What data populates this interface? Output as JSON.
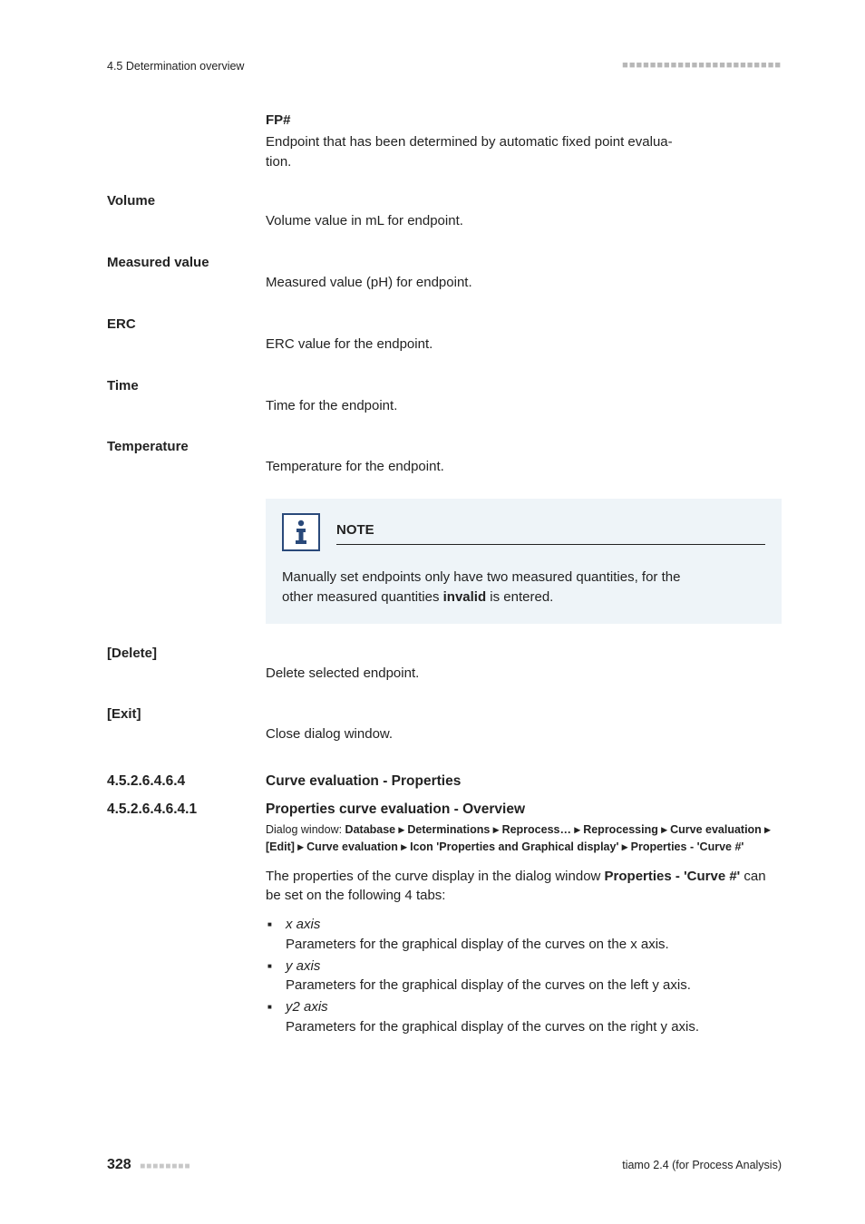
{
  "header": {
    "left": "4.5 Determination overview",
    "right": "■■■■■■■■■■■■■■■■■■■■■■■"
  },
  "fp": {
    "title": "FP#",
    "desc_a": "Endpoint that has been determined by automatic fixed point evalua-",
    "desc_b": "tion."
  },
  "defs": {
    "volume": {
      "label": "Volume",
      "text": "Volume value in mL for endpoint."
    },
    "measured": {
      "label": "Measured value",
      "text": "Measured value (pH) for endpoint."
    },
    "erc": {
      "label": "ERC",
      "text": "ERC value for the endpoint."
    },
    "time": {
      "label": "Time",
      "text": "Time for the endpoint."
    },
    "temp": {
      "label": "Temperature",
      "text": "Temperature for the endpoint."
    }
  },
  "note": {
    "head": "NOTE",
    "line1": "Manually set endpoints only have two measured quantities, for the",
    "line2_a": "other measured quantities ",
    "line2_b": "invalid",
    "line2_c": " is entered."
  },
  "actions": {
    "delete": {
      "label": "[Delete]",
      "text": "Delete selected endpoint."
    },
    "exit": {
      "label": "[Exit]",
      "text": "Close dialog window."
    }
  },
  "sections": {
    "s1": {
      "num": "4.5.2.6.4.6.4",
      "title": "Curve evaluation - Properties"
    },
    "s2": {
      "num": "4.5.2.6.4.6.4.1",
      "title": "Properties curve evaluation - Overview"
    }
  },
  "crumb": {
    "lead": "Dialog window: ",
    "path": "Database ▸ Determinations ▸ Reprocess… ▸ Reprocessing ▸ Curve evaluation ▸ [Edit] ▸ Curve evaluation ▸ Icon 'Properties and Graphical display' ▸ Properties - 'Curve #'"
  },
  "intro": {
    "a": "The properties of the curve display in the dialog window ",
    "b": "Properties - 'Curve #'",
    "c": " can be set on the following 4 tabs:"
  },
  "tabs": {
    "x": {
      "name": "x axis",
      "desc": "Parameters for the graphical display of the curves on the x axis."
    },
    "y": {
      "name": "y axis",
      "desc": "Parameters for the graphical display of the curves on the left y axis."
    },
    "y2": {
      "name": "y2 axis",
      "desc": "Parameters for the graphical display of the curves on the right y axis."
    }
  },
  "footer": {
    "page": "328",
    "dots": "■■■■■■■■",
    "product": "tiamo 2.4 (for Process Analysis)"
  }
}
